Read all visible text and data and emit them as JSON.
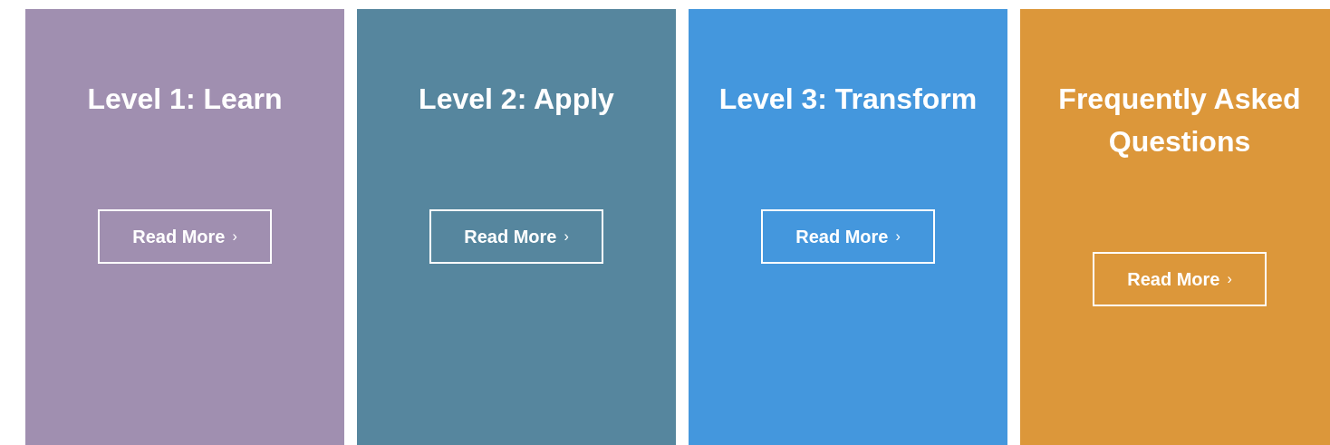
{
  "cards": [
    {
      "title": "Level 1: Learn",
      "color": "#a08fb0",
      "button": {
        "label": "Read More",
        "icon": "›"
      }
    },
    {
      "title": "Level 2: Apply",
      "color": "#56869e",
      "button": {
        "label": "Read More",
        "icon": "›"
      }
    },
    {
      "title": "Level 3: Transform",
      "color": "#4497dd",
      "button": {
        "label": "Read More",
        "icon": "›"
      }
    },
    {
      "title": "Frequently Asked Questions",
      "color": "#dc973a",
      "button": {
        "label": "Read More",
        "icon": "›"
      }
    }
  ]
}
